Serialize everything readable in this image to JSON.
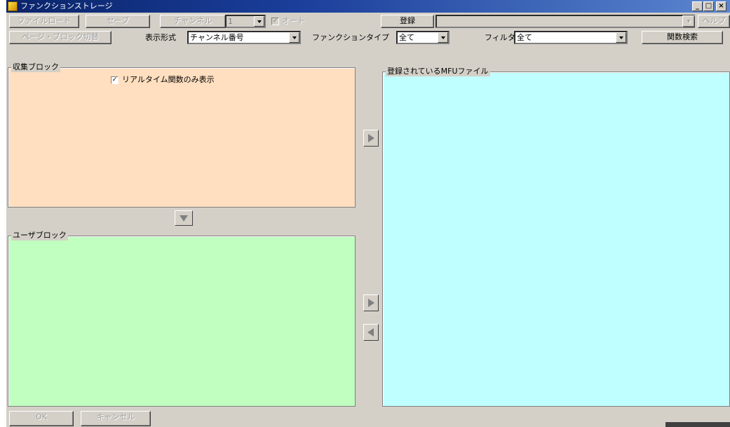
{
  "window": {
    "title": "ファンクションストレージ"
  },
  "titlebar_buttons": {
    "minimize": "_",
    "maximize": "□",
    "close": "×"
  },
  "toolbar1": {
    "btn1": "ファイルロード",
    "btn2": "セーブ",
    "channel_label": "チャンネル",
    "channel_value": "1",
    "auto_label": "オート",
    "register_button": "登録",
    "register_value": "",
    "right_button": "ヘルプ"
  },
  "toolbar2": {
    "btn1": "ページ・ブロック切替",
    "display_format_label": "表示形式",
    "display_format_value": "チャンネル番号",
    "function_type_label": "ファンクションタイプ",
    "function_type_value": "全て",
    "filter_label": "フィルタ",
    "filter_value": "全て",
    "search_button": "関数検索"
  },
  "collect_block": {
    "legend": "収集ブロック",
    "realtime_checkbox_label": "リアルタイム関数のみ表示",
    "realtime_checked": true
  },
  "user_block": {
    "legend": "ユーザブロック"
  },
  "mfu_files": {
    "legend": "登録されているMFUファイル"
  },
  "bottom": {
    "btn1": "OK",
    "btn2": "キャンセル"
  },
  "colors": {
    "collect_bg": "#ffdfc0",
    "user_bg": "#c0ffc0",
    "mfu_bg": "#c0ffff",
    "window_bg": "#d4d0c8",
    "title_start": "#0a246a",
    "title_end": "#5b86d0"
  }
}
